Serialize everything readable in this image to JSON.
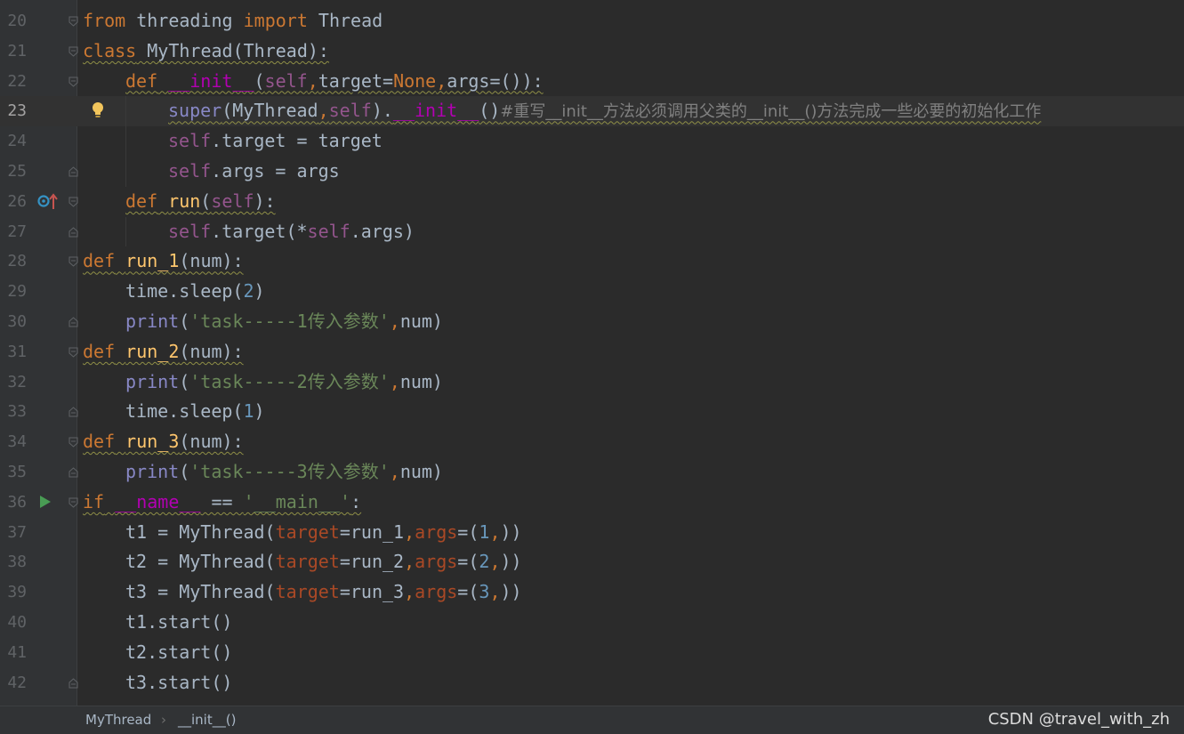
{
  "editor": {
    "lines": [
      {
        "n": "20",
        "text": "from threading import Thread"
      },
      {
        "n": "21",
        "text": "class MyThread(Thread):"
      },
      {
        "n": "22",
        "text": "def __init__(self,target=None,args=()):"
      },
      {
        "n": "23",
        "text": "super(MyThread,self).__init__()#重写__init__方法必须调用父类的__init__()方法完成一些必要的初始化工作"
      },
      {
        "n": "24",
        "text": "self.target = target"
      },
      {
        "n": "25",
        "text": "self.args = args"
      },
      {
        "n": "26",
        "text": "def run(self):"
      },
      {
        "n": "27",
        "text": "self.target(*self.args)"
      },
      {
        "n": "28",
        "text": "def run_1(num):"
      },
      {
        "n": "29",
        "text": "time.sleep(2)"
      },
      {
        "n": "30",
        "text": "print('task-----1传入参数',num)"
      },
      {
        "n": "31",
        "text": "def run_2(num):"
      },
      {
        "n": "32",
        "text": "print('task-----2传入参数',num)"
      },
      {
        "n": "33",
        "text": "time.sleep(1)"
      },
      {
        "n": "34",
        "text": "def run_3(num):"
      },
      {
        "n": "35",
        "text": "print('task-----3传入参数',num)"
      },
      {
        "n": "36",
        "text": "if __name__ == '__main__':"
      },
      {
        "n": "37",
        "text": "t1 = MyThread(target=run_1,args=(1,))"
      },
      {
        "n": "38",
        "text": "t2 = MyThread(target=run_2,args=(2,))"
      },
      {
        "n": "39",
        "text": "t3 = MyThread(target=run_3,args=(3,))"
      },
      {
        "n": "40",
        "text": "t1.start()"
      },
      {
        "n": "41",
        "text": "t2.start()"
      },
      {
        "n": "42",
        "text": "t3.start()"
      }
    ],
    "current_line": "23"
  },
  "gutter_icons": {
    "line23": "lightbulb-icon",
    "line26": "override-method-icon",
    "line36": "run-icon"
  },
  "breadcrumb": {
    "class_name": "MyThread",
    "method_name": "__init__()"
  },
  "watermark": "CSDN @travel_with_zh",
  "colors": {
    "background": "#2b2b2b",
    "keyword": "#cc7832",
    "self": "#94558d",
    "function": "#ffc66d",
    "number": "#6897bb",
    "string": "#6a8759",
    "comment": "#808080",
    "run_icon": "#499c54"
  }
}
